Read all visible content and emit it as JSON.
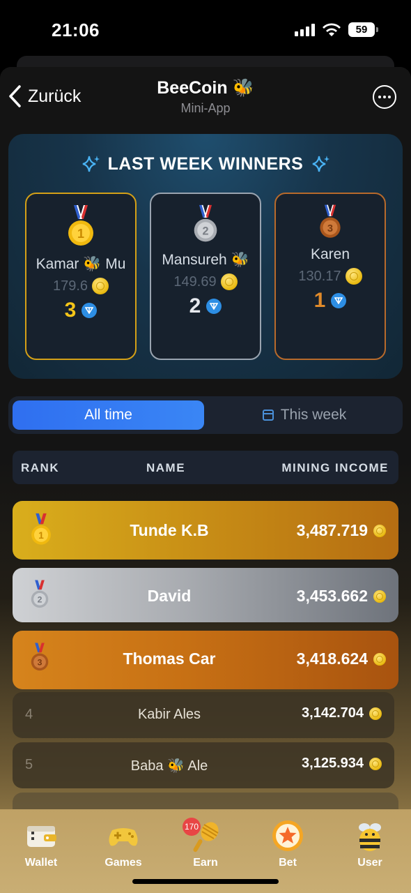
{
  "status_bar": {
    "time": "21:06",
    "battery": "59"
  },
  "header": {
    "back_label": "Zurück",
    "title": "BeeCoin 🐝",
    "subtitle": "Mini-App"
  },
  "winners": {
    "title": "LAST WEEK WINNERS",
    "cards": [
      {
        "rank": "1",
        "name": "Kamar 🐝 Mu",
        "score": "179.6",
        "prize": "3",
        "prize_color": "#f5c518"
      },
      {
        "rank": "2",
        "name": "Mansureh 🐝",
        "score": "149.69",
        "prize": "2",
        "prize_color": "#e6e9ee"
      },
      {
        "rank": "3",
        "name": "Karen",
        "score": "130.17",
        "prize": "1",
        "prize_color": "#e08a2a"
      }
    ]
  },
  "tabs": {
    "all_time": "All time",
    "this_week": "This week",
    "active": "all_time"
  },
  "table": {
    "headers": {
      "rank": "RANK",
      "name": "NAME",
      "income": "MINING INCOME"
    },
    "rows": [
      {
        "rank": "1",
        "name": "Tunde K.B",
        "income": "3,487.719"
      },
      {
        "rank": "2",
        "name": "David",
        "income": "3,453.662"
      },
      {
        "rank": "3",
        "name": "Thomas Car",
        "income": "3,418.624"
      },
      {
        "rank": "4",
        "name": "Kabir Ales",
        "income": "3,142.704"
      },
      {
        "rank": "5",
        "name": "Baba 🐝 Ale",
        "income": "3,125.934"
      }
    ]
  },
  "nav": {
    "items": [
      {
        "label": "Wallet",
        "icon": "wallet-icon"
      },
      {
        "label": "Games",
        "icon": "gamepad-icon"
      },
      {
        "label": "Earn",
        "icon": "honey-dipper-icon",
        "badge": "170"
      },
      {
        "label": "Bet",
        "icon": "star-badge-icon"
      },
      {
        "label": "User",
        "icon": "bee-icon"
      }
    ]
  },
  "colors": {
    "accent": "#2f6ff0",
    "gold": "#d9ae1c",
    "silver": "#a8abb0",
    "bronze": "#c77014"
  }
}
